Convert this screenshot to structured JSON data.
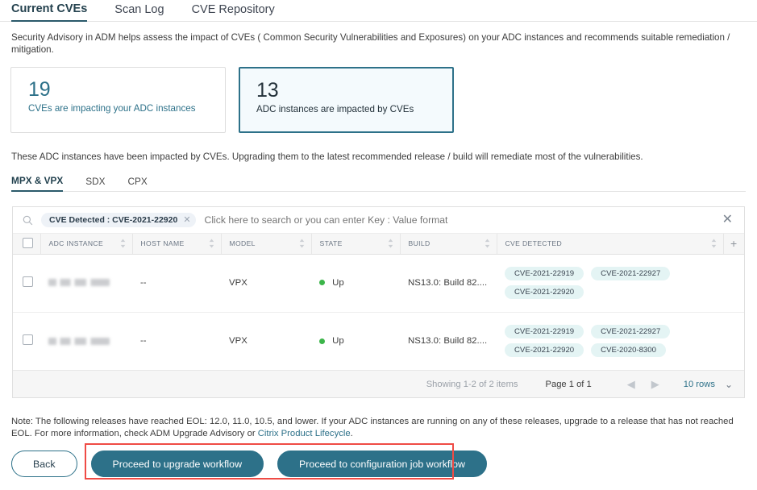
{
  "top_tabs": [
    {
      "label": "Current CVEs",
      "active": true
    },
    {
      "label": "Scan Log",
      "active": false
    },
    {
      "label": "CVE Repository",
      "active": false
    }
  ],
  "intro": "Security Advisory in ADM helps assess the impact of CVEs ( Common Security Vulnerabilities and Exposures) on your ADC instances and recommends suitable remediation / mitigation.",
  "cards": [
    {
      "number": "19",
      "label": "CVEs are impacting your ADC instances",
      "selected": false
    },
    {
      "number": "13",
      "label": "ADC instances are impacted by CVEs",
      "selected": true
    }
  ],
  "subtext": "These ADC instances have been impacted by CVEs. Upgrading them to the latest recommended release / build will remediate most of the vulnerabilities.",
  "type_tabs": [
    {
      "label": "MPX & VPX",
      "active": true
    },
    {
      "label": "SDX",
      "active": false
    },
    {
      "label": "CPX",
      "active": false
    }
  ],
  "search": {
    "icon": "search-icon",
    "chip_label": "CVE Detected : CVE-2021-22920",
    "chip_remove": "✕",
    "placeholder": "Click here to search or you can enter Key : Value format",
    "value": "",
    "clear_icon": "✕"
  },
  "table": {
    "columns": [
      "ADC INSTANCE",
      "HOST NAME",
      "MODEL",
      "STATE",
      "BUILD",
      "CVE DETECTED"
    ],
    "add_column_icon": "+",
    "rows": [
      {
        "adc_instance": "",
        "host_name": "--",
        "model": "VPX",
        "state": "Up",
        "build": "NS13.0: Build 82....",
        "cves": [
          "CVE-2021-22919",
          "CVE-2021-22927",
          "CVE-2021-22920"
        ]
      },
      {
        "adc_instance": "",
        "host_name": "--",
        "model": "VPX",
        "state": "Up",
        "build": "NS13.0: Build 82....",
        "cves": [
          "CVE-2021-22919",
          "CVE-2021-22927",
          "CVE-2021-22920",
          "CVE-2020-8300"
        ]
      }
    ]
  },
  "pagination": {
    "showing": "Showing 1-2 of 2 items",
    "page": "Page 1 of 1",
    "prev_icon": "◀",
    "next_icon": "▶",
    "rows_per_page": "10 rows",
    "caret_icon": "⌄"
  },
  "note": {
    "text_before": "Note: The following releases have reached EOL: 12.0, 11.0, 10.5, and lower. If your ADC instances are running on any of these releases, upgrade to a release that has not reached EOL. For more information, check ADM Upgrade Advisory or ",
    "link": "Citrix Product Lifecycle",
    "text_after": "."
  },
  "actions": {
    "back": "Back",
    "upgrade": "Proceed to upgrade workflow",
    "config_job": "Proceed to configuration job workflow"
  },
  "colors": {
    "accent": "#2d7189",
    "accent_dark": "#2b5a6b",
    "status_up": "#3cb54a",
    "tag_bg": "#e4f4f4",
    "annotation": "#ef4b45",
    "selected_card_bg": "#f4fafd"
  }
}
